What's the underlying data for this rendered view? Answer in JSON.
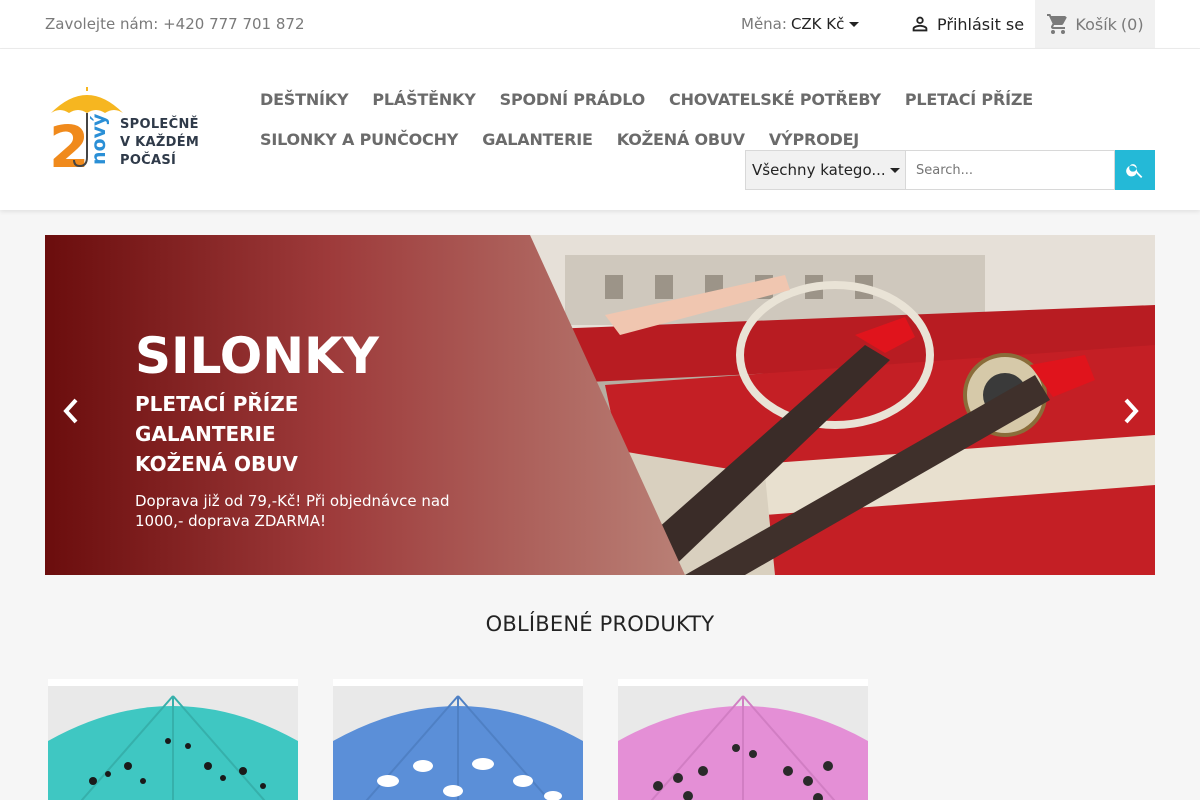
{
  "topbar": {
    "contact": "Zavolejte nám: +420 777 701 872",
    "currency_label": "Měna:",
    "currency_value": "CZK Kč",
    "signin": "Přihlásit se",
    "cart_label": "Košík",
    "cart_count": "(0)"
  },
  "logo": {
    "alt": "2NOVY Společně v každém počasí",
    "line1": "SPOLEČNĚ",
    "line2": "V KAŽDÉM",
    "line3": "POČASÍ",
    "number": "2",
    "word": "nový"
  },
  "nav": {
    "row1": [
      "DEŠTNÍKY",
      "PLÁŠTĚNKY",
      "SPODNÍ PRÁDLO",
      "CHOVATELSKÉ POTŘEBY",
      "PLETACÍ PŘÍZE"
    ],
    "row2": [
      "SILONKY A PUNČOCHY",
      "GALANTERIE",
      "KOŽENÁ OBUV",
      "VÝPRODEJ"
    ]
  },
  "search": {
    "category": "Všechny katego...",
    "placeholder": "Search..."
  },
  "hero": {
    "title": "SILONKY",
    "lines": [
      "PLETACÍ PŘÍZE",
      "GALANTERIE",
      "KOŽENÁ OBUV"
    ],
    "note": "Doprava již od 79,-Kč! Při objednávce nad 1000,- doprava ZDARMA!"
  },
  "section": {
    "title": "OBLÍBENÉ PRODUKTY"
  },
  "products": [
    {
      "color": "#3fc7c2",
      "pattern": "paws"
    },
    {
      "color": "#5b8fd8",
      "pattern": "clouds"
    },
    {
      "color": "#e48fd6",
      "pattern": "skulls"
    }
  ],
  "colors": {
    "accent": "#24b9d7",
    "hero_overlay": "#8b1d1d"
  }
}
